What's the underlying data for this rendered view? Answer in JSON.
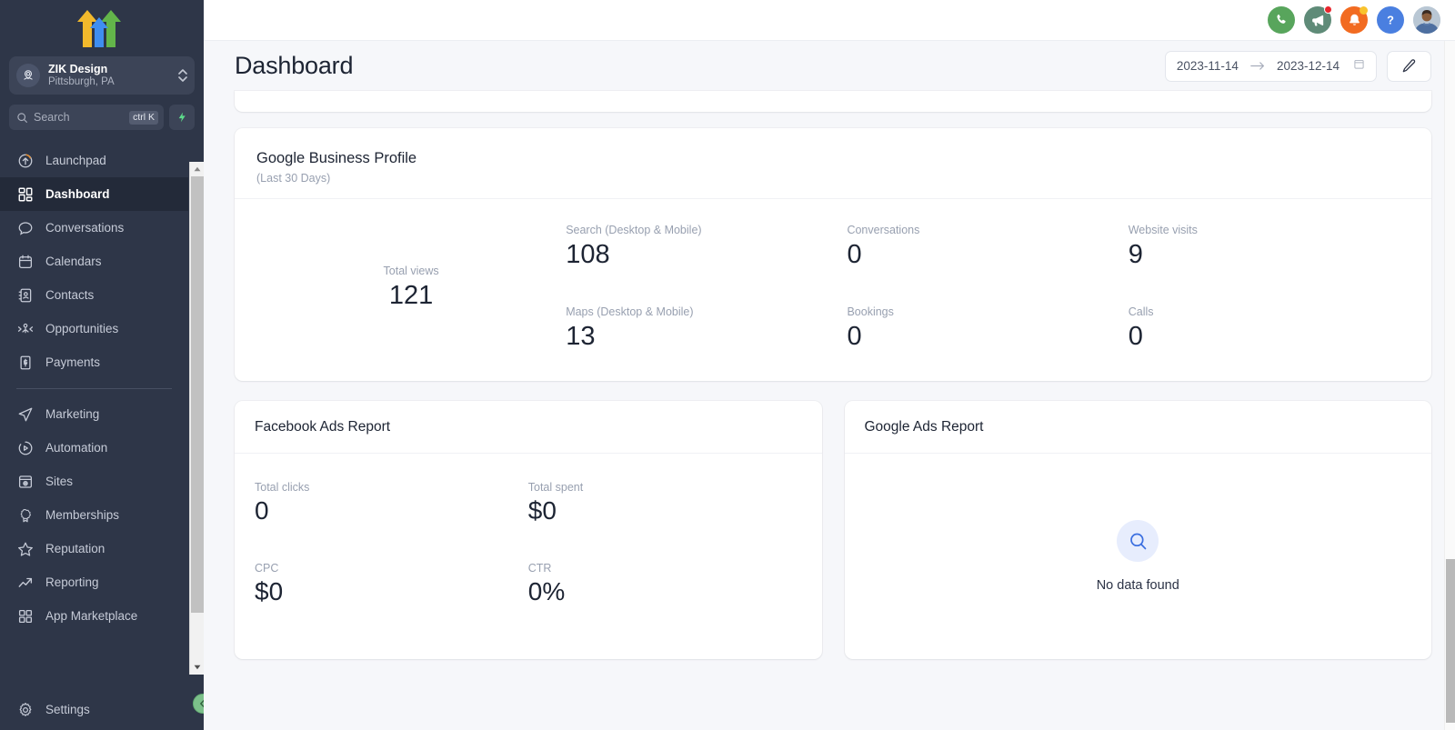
{
  "sidebar": {
    "logo_icon": "three-arrows-logo",
    "location": {
      "name": "ZIK Design",
      "sublabel": "Pittsburgh, PA",
      "avatar_icon": "location-pin-icon",
      "chevron_icon": "chevron-up-down-icon"
    },
    "search": {
      "placeholder": "Search",
      "shortcut": "ctrl K",
      "search_icon": "search-icon",
      "bolt_icon": "lightning-bolt-icon"
    },
    "nav_primary": [
      {
        "label": "Launchpad",
        "icon": "rocket-launchpad-icon",
        "active": false
      },
      {
        "label": "Dashboard",
        "icon": "dashboard-grid-icon",
        "active": true
      },
      {
        "label": "Conversations",
        "icon": "chat-bubble-icon",
        "active": false
      },
      {
        "label": "Calendars",
        "icon": "calendar-icon",
        "active": false
      },
      {
        "label": "Contacts",
        "icon": "contacts-book-icon",
        "active": false
      },
      {
        "label": "Opportunities",
        "icon": "opportunities-icon",
        "active": false
      },
      {
        "label": "Payments",
        "icon": "payments-invoice-icon",
        "active": false
      }
    ],
    "nav_secondary": [
      {
        "label": "Marketing",
        "icon": "paper-plane-icon",
        "active": false
      },
      {
        "label": "Automation",
        "icon": "play-circle-icon",
        "active": false
      },
      {
        "label": "Sites",
        "icon": "sites-window-icon",
        "active": false
      },
      {
        "label": "Memberships",
        "icon": "award-badge-icon",
        "active": false
      },
      {
        "label": "Reputation",
        "icon": "star-icon",
        "active": false
      },
      {
        "label": "Reporting",
        "icon": "trend-up-icon",
        "active": false
      },
      {
        "label": "App Marketplace",
        "icon": "app-grid-icon",
        "active": false
      }
    ],
    "nav_bottom": [
      {
        "label": "Settings",
        "icon": "gear-icon",
        "active": false
      }
    ],
    "collapse_icon": "chevron-left-icon"
  },
  "topbar": {
    "actions": [
      {
        "name": "call-button",
        "icon": "phone-icon",
        "color": "#58a55c",
        "badge": null
      },
      {
        "name": "announcements-button",
        "icon": "megaphone-icon",
        "color": "#5f8b78",
        "badge": "red"
      },
      {
        "name": "notifications-button",
        "icon": "bell-icon",
        "color": "#f26b21",
        "badge": "yellow"
      },
      {
        "name": "help-button",
        "icon": "question-mark-icon",
        "color": "#4a7fe0",
        "badge": null
      }
    ],
    "profile": {
      "name": "user-avatar",
      "icon": "avatar-photo"
    }
  },
  "page": {
    "title": "Dashboard",
    "date_range": {
      "start": "2023-11-14",
      "end": "2023-12-14",
      "arrow_icon": "arrow-right-icon",
      "calendar_icon": "calendar-icon"
    },
    "edit_button": {
      "icon": "pencil-edit-icon"
    }
  },
  "gbp_card": {
    "title": "Google Business Profile",
    "subtitle": "(Last 30 Days)",
    "total": {
      "label": "Total views",
      "value": "121"
    },
    "metrics": [
      {
        "label": "Search (Desktop & Mobile)",
        "value": "108"
      },
      {
        "label": "Maps (Desktop & Mobile)",
        "value": "13"
      },
      {
        "label": "Conversations",
        "value": "0"
      },
      {
        "label": "Bookings",
        "value": "0"
      },
      {
        "label": "Website visits",
        "value": "9"
      },
      {
        "label": "Calls",
        "value": "0"
      }
    ]
  },
  "facebook_ads": {
    "title": "Facebook Ads Report",
    "metrics": [
      {
        "label": "Total clicks",
        "value": "0"
      },
      {
        "label": "Total spent",
        "value": "$0"
      },
      {
        "label": "CPC",
        "value": "$0"
      },
      {
        "label": "CTR",
        "value": "0%"
      }
    ]
  },
  "google_ads": {
    "title": "Google Ads Report",
    "empty_state": {
      "text": "No data found",
      "icon": "magnifier-search-icon"
    }
  },
  "colors": {
    "sidebar_bg": "#2e3648",
    "sidebar_active": "#232a39",
    "page_bg": "#f6f7fa",
    "card_bg": "#ffffff",
    "text_primary": "#1d2433",
    "text_muted": "#98a0b0",
    "accent_blue": "#4a7fe0",
    "accent_green": "#58a55c",
    "accent_orange": "#f26b21"
  }
}
